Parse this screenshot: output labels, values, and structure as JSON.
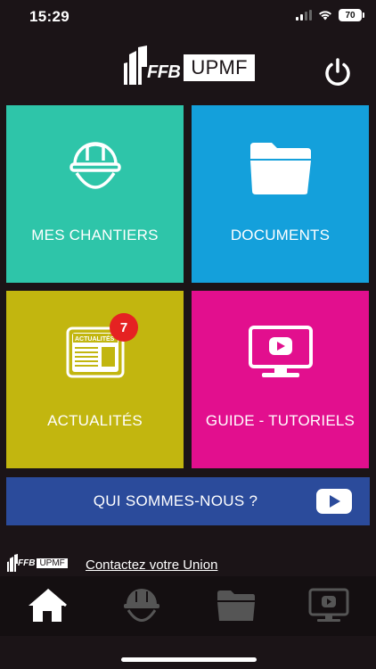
{
  "status_bar": {
    "time": "15:29",
    "battery": "70"
  },
  "brand": {
    "ffb": "FFB",
    "upmf": "UPMF"
  },
  "tiles": [
    {
      "label": "MES CHANTIERS",
      "icon": "helmet-icon",
      "color": "#2ec5a9"
    },
    {
      "label": "DOCUMENTS",
      "icon": "folder-icon",
      "color": "#14a0db"
    },
    {
      "label": "ACTUALITÉS",
      "icon": "newspaper-icon",
      "color": "#c2b60f",
      "badge": "7",
      "newspaper_title": "ACTUALITÉS"
    },
    {
      "label": "GUIDE - TUTORIELS",
      "icon": "video-monitor-icon",
      "color": "#e20f8e"
    }
  ],
  "banner": {
    "label": "QUI SOMMES-NOUS ?",
    "color": "#2b4b9b"
  },
  "footer": {
    "ffb": "FFB",
    "upmf": "UPMF",
    "contact": "Contactez votre Union"
  },
  "tabbar": [
    {
      "icon": "home-icon",
      "active": true
    },
    {
      "icon": "helmet-icon",
      "active": false
    },
    {
      "icon": "folder-icon",
      "active": false
    },
    {
      "icon": "video-monitor-icon",
      "active": false
    }
  ]
}
